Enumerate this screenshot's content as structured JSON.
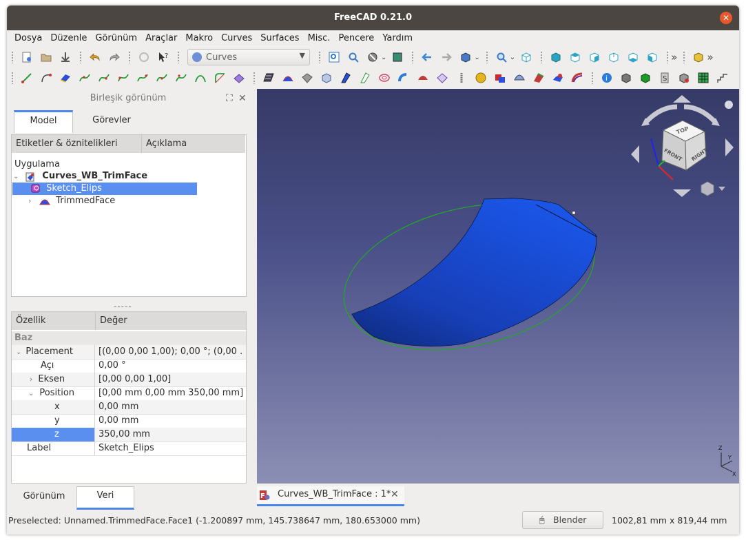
{
  "window": {
    "title": "FreeCAD 0.21.0",
    "close": "✕"
  },
  "menu": [
    "Dosya",
    "Düzenle",
    "Görünüm",
    "Araçlar",
    "Makro",
    "Curves",
    "Surfaces",
    "Misc.",
    "Pencere",
    "Yardım"
  ],
  "toolbar": {
    "workbench": "Curves",
    "overflow": "»"
  },
  "combo": {
    "title": "Birleşik görünüm",
    "tabs": [
      "Model",
      "Görevler"
    ]
  },
  "tree": {
    "columns": [
      "Etiketler & öznitelikleri",
      "Açıklama"
    ],
    "root": "Uygulama",
    "document": "Curves_WB_TrimFace",
    "items": [
      "Sketch_Elips",
      "TrimmedFace"
    ]
  },
  "splitter": "-----",
  "properties": {
    "columns": [
      "Özellik",
      "Değer"
    ],
    "group": "Baz",
    "rows": [
      {
        "name": "Placement",
        "value": "[(0,00 0,00 1,00); 0,00 °; (0,00 ..."
      },
      {
        "name": "Açı",
        "value": "0,00 °"
      },
      {
        "name": "Eksen",
        "value": "[0,00 0,00 1,00]"
      },
      {
        "name": "Position",
        "value": "[0,00 mm  0,00 mm  350,00 mm]"
      },
      {
        "name": "x",
        "value": "0,00 mm"
      },
      {
        "name": "y",
        "value": "0,00 mm"
      },
      {
        "name": "z",
        "value": "350,00 mm"
      },
      {
        "name": "Label",
        "value": "Sketch_Elips"
      }
    ]
  },
  "bottom_tabs": [
    "Görünüm",
    "Veri"
  ],
  "doc_tab": {
    "label": "Curves_WB_TrimFace : 1*",
    "close": "✕"
  },
  "navcube": {
    "faces": [
      "TOP",
      "FRONT",
      "RIGHT"
    ]
  },
  "axes": [
    "Z",
    "Y",
    "X"
  ],
  "status": {
    "preselected": "Preselected: Unnamed.TrimmedFace.Face1 (-1.200897 mm, 145.738647 mm, 180.653000 mm)",
    "nav_style": "Blender",
    "dimensions": "1002,81 mm x 819,44 mm"
  },
  "colors": {
    "selection": "#5a8ff0",
    "face": "#1a4fd8",
    "ellipse": "#22aa22",
    "tab_accent": "#4a86e8"
  }
}
